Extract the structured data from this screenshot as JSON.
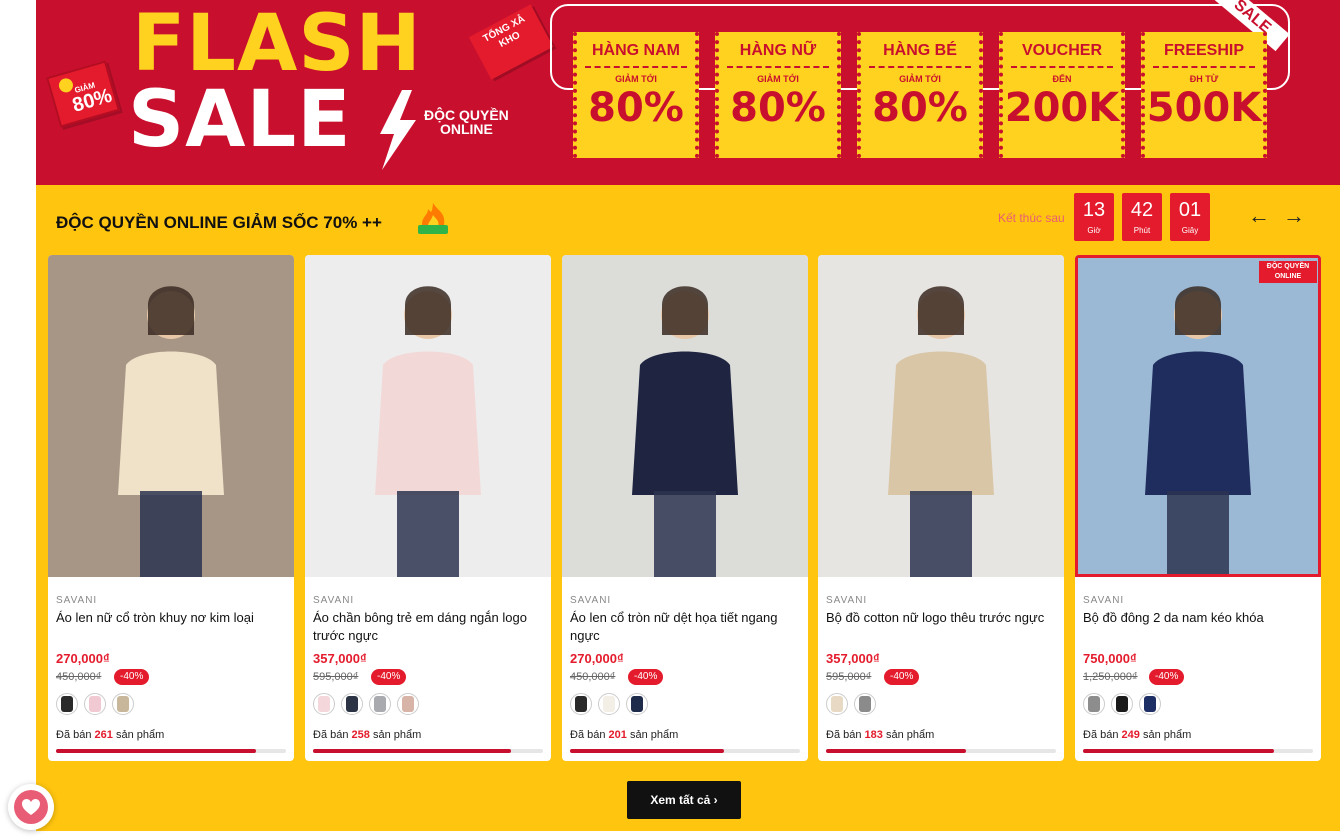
{
  "banner": {
    "flash": "FLASH",
    "sale": "SALE",
    "exclusive_line1": "ĐỘC QUYỀN",
    "exclusive_line2": "ONLINE",
    "badge_80_small": "GIẢM",
    "badge_80_value": "80%",
    "tong_xa_kho": "TỔNG XẢ KHO",
    "sale_ribbon": "SALE",
    "coupons": [
      {
        "title": "HÀNG NAM",
        "sub": "GIẢM TỚI",
        "value": "80%"
      },
      {
        "title": "HÀNG NỮ",
        "sub": "GIẢM TỚI",
        "value": "80%"
      },
      {
        "title": "HÀNG BÉ",
        "sub": "GIẢM TỚI",
        "value": "80%"
      },
      {
        "title": "VOUCHER",
        "sub": "ĐẾN",
        "value": "200K"
      },
      {
        "title": "FREESHIP",
        "sub": "ĐH TỪ",
        "value": "500K"
      }
    ]
  },
  "section": {
    "title": "ĐỘC QUYỀN ONLINE GIẢM SỐC 70% ++",
    "countdown_label": "Kết thúc sau",
    "countdown": [
      {
        "value": "13",
        "unit": "Giờ"
      },
      {
        "value": "42",
        "unit": "Phút"
      },
      {
        "value": "01",
        "unit": "Giây"
      }
    ],
    "prev_icon": "arrow-left-icon",
    "next_icon": "arrow-right-icon",
    "view_all": "Xem tất cả"
  },
  "products": [
    {
      "brand": "SAVANI",
      "name": "Áo len nữ cổ tròn khuy nơ kim loại",
      "price": "270,000₫",
      "old_price": "450,000₫",
      "discount": "-40%",
      "sold_prefix": "Đã bán",
      "sold": "261",
      "sold_suffix": "sản phẩm",
      "sold_progress": 0.87,
      "swatch_colors": [
        "#2a2a2a",
        "#f1c9d2",
        "#c9b79c"
      ],
      "image_bg": "#a79685",
      "garment": "#efe2c8",
      "badge": ""
    },
    {
      "brand": "SAVANI",
      "name": "Áo chần bông trẻ em dáng ngắn logo trước ngực",
      "price": "357,000₫",
      "old_price": "595,000₫",
      "discount": "-40%",
      "sold_prefix": "Đã bán",
      "sold": "258",
      "sold_suffix": "sản phẩm",
      "sold_progress": 0.86,
      "swatch_colors": [
        "#f3d7da",
        "#2b3344",
        "#a9aab0",
        "#d8b4a8"
      ],
      "image_bg": "#ededed",
      "garment": "#f2d9d8",
      "badge": ""
    },
    {
      "brand": "SAVANI",
      "name": "Áo len cổ tròn nữ dệt họa tiết ngang ngực",
      "price": "270,000₫",
      "old_price": "450,000₫",
      "discount": "-40%",
      "sold_prefix": "Đã bán",
      "sold": "201",
      "sold_suffix": "sản phẩm",
      "sold_progress": 0.67,
      "swatch_colors": [
        "#2a2a2a",
        "#f4efe6",
        "#1f2b4a"
      ],
      "image_bg": "#dcdcd8",
      "garment": "#1f2440",
      "badge": ""
    },
    {
      "brand": "SAVANI",
      "name": "Bộ đồ cotton nữ logo thêu trước ngực",
      "price": "357,000₫",
      "old_price": "595,000₫",
      "discount": "-40%",
      "sold_prefix": "Đã bán",
      "sold": "183",
      "sold_suffix": "sản phẩm",
      "sold_progress": 0.61,
      "swatch_colors": [
        "#e7d9c4",
        "#8b8b8b"
      ],
      "image_bg": "#e7e5e1",
      "garment": "#d9c6a6",
      "badge": ""
    },
    {
      "brand": "SAVANI",
      "name": "Bộ đồ đông 2 da nam kéo khóa",
      "price": "750,000₫",
      "old_price": "1,250,000₫",
      "discount": "-40%",
      "sold_prefix": "Đã bán",
      "sold": "249",
      "sold_suffix": "sản phẩm",
      "sold_progress": 0.83,
      "swatch_colors": [
        "#8d8d8d",
        "#1a1a1a",
        "#1e2f66"
      ],
      "image_bg": "#9bb8d4",
      "garment": "#1f2d5e",
      "badge": "ĐỘC QUYỀN ONLINE"
    }
  ],
  "favorite_icon": "heart-icon",
  "colors": {
    "banner_red": "#c8102e",
    "yellow": "#ffc50f",
    "accent_red": "#e41b2c"
  }
}
